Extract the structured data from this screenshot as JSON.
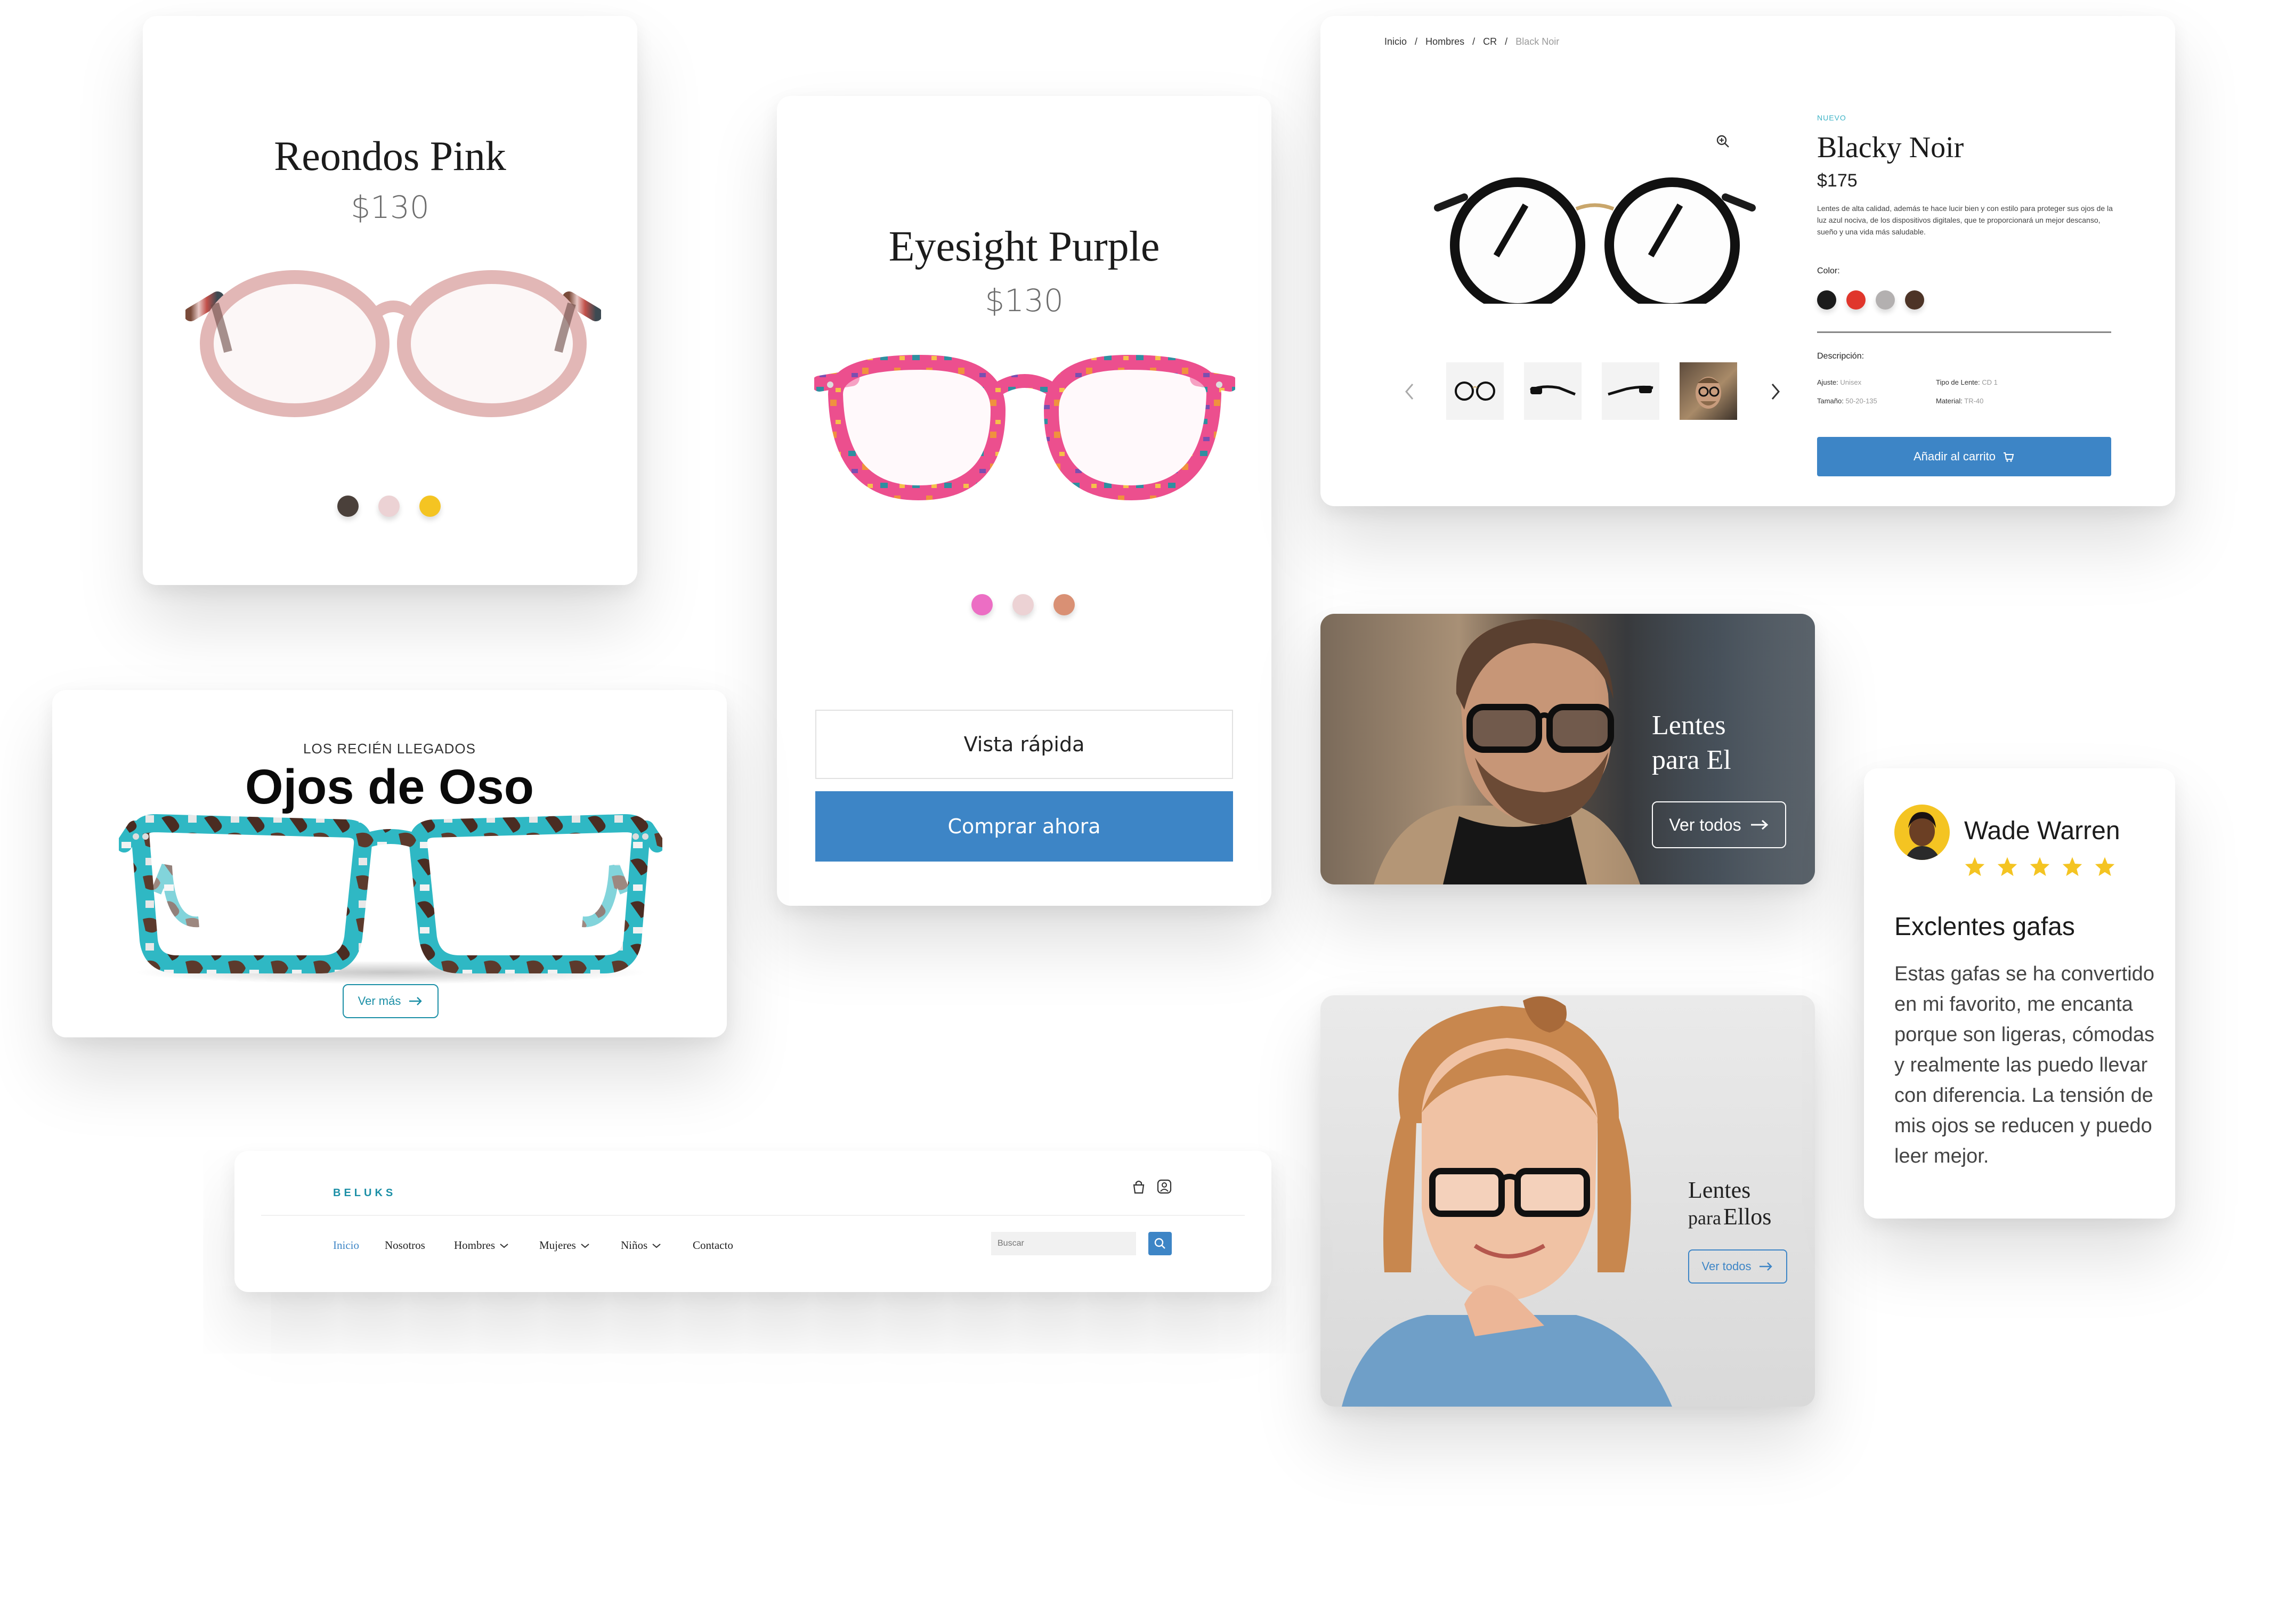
{
  "card_reondos": {
    "title": "Reondos Pink",
    "price": "$130",
    "colors": [
      "#4a403a",
      "#ecd2d4",
      "#f4c422"
    ]
  },
  "card_eyesight": {
    "title": "Eyesight Purple",
    "price": "$130",
    "colors": [
      "#ec6ec4",
      "#ecd2d4",
      "#d99074"
    ],
    "quick_view_label": "Vista rápida",
    "buy_now_label": "Comprar ahora"
  },
  "card_oso": {
    "eyebrow": "LOS RECIÉN LLEGADOS",
    "title": "Ojos de Oso",
    "cta_label": "Ver más"
  },
  "product_detail": {
    "breadcrumb": [
      "Inicio",
      "Hombres",
      "CR",
      "Black Noir"
    ],
    "breadcrumb_sep": "/",
    "badge": "NUEVO",
    "title": "Blacky Noir",
    "price": "$175",
    "description": "Lentes de alta calidad, además te hace lucir bien y con estilo para proteger sus ojos de la luz azul nociva, de los dispositivos digitales, que te proporcionará un mejor descanso, sueño y una vida más saludable.",
    "color_label": "Color:",
    "colors": [
      "#1b1b1b",
      "#e0362c",
      "#b3b0b0",
      "#4d3427"
    ],
    "desc_label": "Descripción:",
    "specs": [
      {
        "label": "Ajuste:",
        "value": "Unisex"
      },
      {
        "label": "Tipo de Lente:",
        "value": "CD 1"
      },
      {
        "label": "Tamaño:",
        "value": "50-20-135"
      },
      {
        "label": "Material:",
        "value": "TR-40"
      }
    ],
    "add_to_cart_label": "Añadir al carrito"
  },
  "banner_el": {
    "title_line1": "Lentes",
    "title_line2": "para El",
    "cta_label": "Ver todos"
  },
  "banner_ellos": {
    "title_line1": "Lentes",
    "title_line2_a": "para",
    "title_line2_b": "Ellos",
    "cta_label": "Ver todos"
  },
  "review": {
    "name": "Wade Warren",
    "rating": 5,
    "heading": "Exclentes gafas",
    "body": "Estas gafas se ha convertido en mi favorito, me encanta porque son ligeras, cómodas y realmente las puedo llevar con diferencia. La tensión de mis ojos se reducen y puedo leer mejor.",
    "star_color": "#f4c422"
  },
  "navbar": {
    "brand": "BELUKS",
    "links": [
      {
        "label": "Inicio",
        "active": true
      },
      {
        "label": "Nosotros"
      },
      {
        "label": "Hombres",
        "dropdown": true
      },
      {
        "label": "Mujeres",
        "dropdown": true
      },
      {
        "label": "Niños",
        "dropdown": true
      },
      {
        "label": "Contacto"
      }
    ],
    "search_placeholder": "Buscar"
  },
  "theme": {
    "accent": "#3d85c6",
    "teal": "#1b8fa6"
  }
}
